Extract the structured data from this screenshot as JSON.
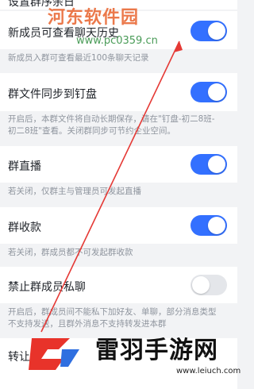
{
  "watermark": {
    "site_name": "河东软件园",
    "site_url": "www.pc0359.cn",
    "brand_name": "雷羽手游网",
    "brand_url": "www.leiuch.com"
  },
  "top_row": {
    "label": "设置群序余日"
  },
  "settings": [
    {
      "label": "新成员可查看聊天历史",
      "state": "on",
      "desc": "新成员入群可查看最近100条聊天记录"
    },
    {
      "label": "群文件同步到钉盘",
      "state": "on",
      "desc": "开启后，本群文件将自动长期保存，请在\"钉盘-初二8班-初二8班\"查看。关闭群同步可节约企业空间。"
    },
    {
      "label": "群直播",
      "state": "on",
      "desc": "若关闭，仅群主与管理员可发起直播"
    },
    {
      "label": "群收款",
      "state": "on",
      "desc": "若关闭，群成员都不可发起群收款"
    },
    {
      "label": "禁止群成员私聊",
      "state": "off",
      "desc": "开启后，群成员间不能私下加好友、单聊，部分消息类型不支持发送，且群外消息不支持转发进本群"
    }
  ],
  "bottom_row": {
    "label": "转让群"
  },
  "colors": {
    "accent": "#3370ff",
    "arrow": "#e53935"
  }
}
